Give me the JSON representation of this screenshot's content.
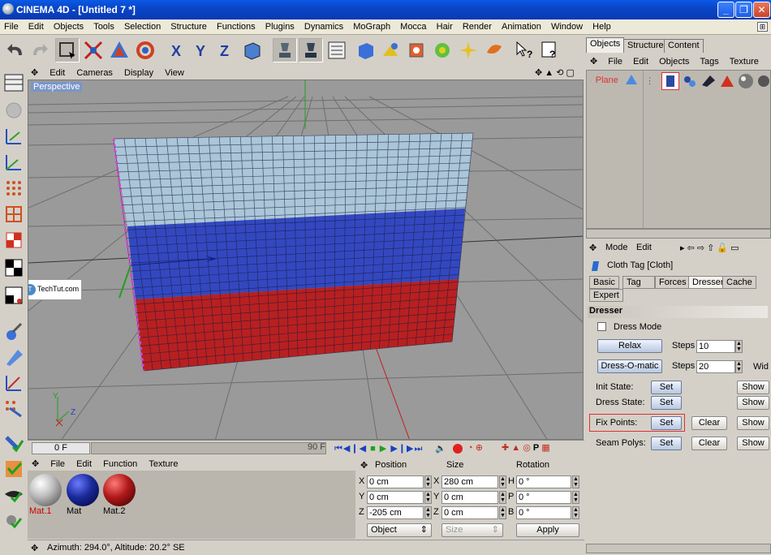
{
  "window": {
    "title": "CINEMA 4D - [Untitled 7 *]"
  },
  "menubar": {
    "items": [
      "File",
      "Edit",
      "Objects",
      "Tools",
      "Selection",
      "Structure",
      "Functions",
      "Plugins",
      "Dynamics",
      "MoGraph",
      "Mocca",
      "Hair",
      "Render",
      "Animation",
      "Window",
      "Help"
    ]
  },
  "viewport": {
    "menu": [
      "Edit",
      "Cameras",
      "Display",
      "View"
    ],
    "label": "Perspective",
    "watermark": "TechTut.com",
    "axis": {
      "y": "Y",
      "z": "Z"
    }
  },
  "timeline": {
    "start": "0 F",
    "end": "90 F"
  },
  "materials": {
    "menu": [
      "File",
      "Edit",
      "Function",
      "Texture"
    ],
    "items": [
      {
        "name": "Mat.1",
        "color": "#c0c0c0",
        "label_color": "#cc0000"
      },
      {
        "name": "Mat",
        "color": "#1a2a9a",
        "label_color": "#000000"
      },
      {
        "name": "Mat.2",
        "color": "#b01818",
        "label_color": "#000000"
      }
    ]
  },
  "coordinates": {
    "headers": {
      "position": "Position",
      "size": "Size",
      "rotation": "Rotation"
    },
    "rows": [
      {
        "a": "X",
        "pos": "0 cm",
        "b": "X",
        "size": "280 cm",
        "c": "H",
        "rot": "0 °"
      },
      {
        "a": "Y",
        "pos": "0 cm",
        "b": "Y",
        "size": "0 cm",
        "c": "P",
        "rot": "0 °"
      },
      {
        "a": "Z",
        "pos": "-205 cm",
        "b": "Z",
        "size": "0 cm",
        "c": "B",
        "rot": "0 °"
      }
    ],
    "mode": "Object",
    "size_mode": "Size",
    "apply": "Apply"
  },
  "status": {
    "text": "Azimuth: 294.0°, Altitude: 20.2° SE"
  },
  "objects": {
    "tabs": [
      "Objects",
      "Structure",
      "Content"
    ],
    "menu": [
      "File",
      "Edit",
      "Objects",
      "Tags",
      "Texture"
    ],
    "item": "Plane"
  },
  "attributes": {
    "menu": [
      "Mode",
      "Edit"
    ],
    "title": "Cloth Tag [Cloth]",
    "tabs_row1": [
      "Basic",
      "Tag",
      "Forces",
      "Dresser",
      "Cache"
    ],
    "tabs_row2": [
      "Expert"
    ],
    "active_tab": "Dresser",
    "section": "Dresser",
    "dress_mode": "Dress Mode",
    "relax": "Relax",
    "dress_o_matic": "Dress-O-matic",
    "steps_label": "Steps",
    "relax_steps": "10",
    "dom_steps": "20",
    "wid_label": "Wid",
    "rows": [
      {
        "label": "Init State:",
        "set": "Set",
        "clear": "",
        "show": "Show"
      },
      {
        "label": "Dress State:",
        "set": "Set",
        "clear": "",
        "show": "Show"
      },
      {
        "label": "Fix Points:",
        "set": "Set",
        "clear": "Clear",
        "show": "Show"
      },
      {
        "label": "Seam Polys:",
        "set": "Set",
        "clear": "Clear",
        "show": "Show"
      }
    ]
  },
  "colors": {
    "cloth_top": "#aac6d8",
    "cloth_mid": "#3348c0",
    "cloth_bottom": "#b82020",
    "highlight": "#e03030"
  }
}
